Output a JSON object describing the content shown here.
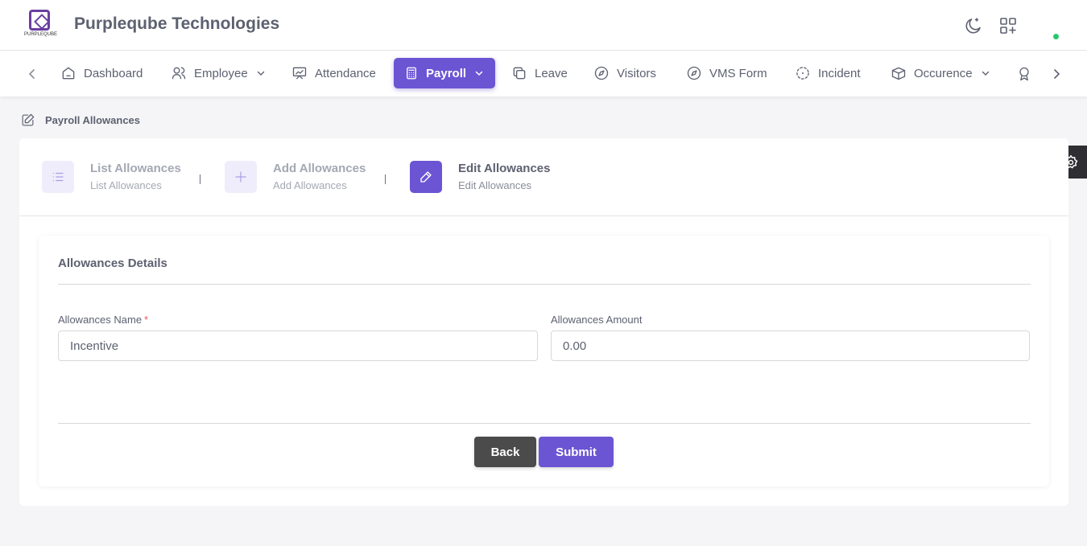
{
  "header": {
    "logo_text": "PURPLEQUBE",
    "company": "Purpleqube Technologies",
    "icons": [
      "moon-icon",
      "apps-add-icon"
    ]
  },
  "nav": {
    "items": [
      {
        "label": "Dashboard",
        "icon": "home-icon"
      },
      {
        "label": "Employee",
        "icon": "users-icon",
        "dropdown": true
      },
      {
        "label": "Attendance",
        "icon": "presentation-icon"
      },
      {
        "label": "Payroll",
        "icon": "calculator-icon",
        "dropdown": true,
        "active": true
      },
      {
        "label": "Leave",
        "icon": "copy-icon"
      },
      {
        "label": "Visitors",
        "icon": "compass-icon"
      },
      {
        "label": "VMS Form",
        "icon": "compass-icon"
      },
      {
        "label": "Incident",
        "icon": "focus-icon"
      },
      {
        "label": "Occurence",
        "icon": "box-icon",
        "dropdown": true
      }
    ]
  },
  "breadcrumb": "Payroll Allowances",
  "steps": [
    {
      "title": "List Allowances",
      "subtitle": "List Allowances",
      "icon": "list-icon"
    },
    {
      "title": "Add Allowances",
      "subtitle": "Add Allowances",
      "icon": "plus-icon"
    },
    {
      "title": "Edit Allowances",
      "subtitle": "Edit Allowances",
      "icon": "pencil-icon",
      "active": true
    }
  ],
  "form": {
    "title": "Allowances Details",
    "name_label": "Allowances Name",
    "required_mark": "*",
    "name_value": "Incentive",
    "amount_label": "Allowances Amount",
    "amount_value": "0.00",
    "back_label": "Back",
    "submit_label": "Submit"
  },
  "colors": {
    "accent": "#6b55d3",
    "brand": "#6a3fa0",
    "status_online": "#28c76f",
    "required": "#ea5455",
    "back_button": "#4b4b4b"
  }
}
